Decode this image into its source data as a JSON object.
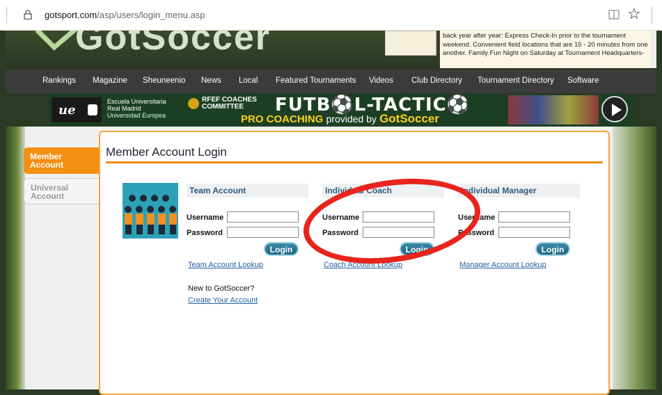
{
  "browser": {
    "url_host": "gotsport.com",
    "url_path": "/asp/users/login_menu.asp"
  },
  "header": {
    "logo_text": "GotSoccer",
    "ad_text": "back year after year: Express Check-In prior to the tournament weekend. Convenient field locations that are 15 - 20 minutes from one another. Family Fun Night on Saturday at Tournament Headquarters-"
  },
  "nav": {
    "items": [
      "Rankings",
      "Magazine",
      "Sheuneenio",
      "News",
      "Local",
      "Featured Tournaments",
      "Videos",
      "Club Directory",
      "Tournament Directory",
      "Software"
    ]
  },
  "banner": {
    "ue": "ue",
    "school_line1": "Escuela Universitaria",
    "school_line2": "Real Madrid",
    "school_line3": "Universidad Europea",
    "rfef_line1": "RFEF COACHES",
    "rfef_line2": "COMMITTEE",
    "futbol": "FUTB⚽L-TACTIC⚽",
    "pro_coaching": "PRO COACHING",
    "provided_by": "provided by",
    "gotsoccer": "GotSoccer"
  },
  "sidebar": {
    "member_line1": "Member",
    "member_line2": "Account",
    "universal_line1": "Universal",
    "universal_line2": "Account"
  },
  "panel": {
    "title": "Member Account Login",
    "columns": [
      {
        "heading": "Team Account",
        "username": "Username",
        "password": "Password",
        "login": "Login",
        "lookup": "Team Account Lookup"
      },
      {
        "heading": "Individual Coach",
        "username": "Username",
        "password": "Password",
        "login": "Login",
        "lookup": "Coach Account Lookup"
      },
      {
        "heading": "Individual Manager",
        "username": "Username",
        "password": "Password",
        "login": "Login",
        "lookup": "Manager Account Lookup"
      }
    ],
    "new_to": "New to GotSoccer?",
    "create": "Create Your Account"
  },
  "colors": {
    "accent": "#f38f12",
    "button": "#1e6582",
    "annotation": "#e8241c"
  }
}
